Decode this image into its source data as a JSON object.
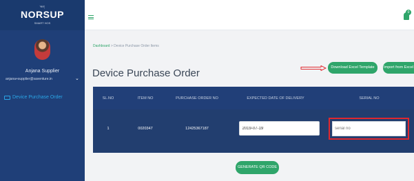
{
  "sidebar": {
    "brand_top": "༄༅།",
    "brand": "NORSUP",
    "brand_tagline": "SMART HOS",
    "user_name": "Anjana Supplier",
    "user_email": "anjana+supplier@saventure.in",
    "nav_items": [
      {
        "label": "Device Purchase Order",
        "icon": "monitor-icon"
      }
    ]
  },
  "topbar": {
    "notification_count": "0"
  },
  "breadcrumb": {
    "home": "Dashboard",
    "separator": ">",
    "current": "Device Purchase Order Items"
  },
  "page": {
    "title": "Device Purchase Order"
  },
  "actions": {
    "download_label": "Download Excel Template",
    "import_label": "Import from Excel"
  },
  "table": {
    "headers": [
      "SL.NO",
      "ITEM NO",
      "PURCHASE ORDER NO",
      "EXPECTED DATE OF DELIVERY",
      "SERIAL NO"
    ],
    "rows": [
      {
        "sl_no": "1",
        "item_no": "0020347",
        "po_no": "12425367187",
        "expected_date": "2019-07-19",
        "serial_placeholder": "serial no"
      }
    ]
  },
  "qr_button": {
    "label": "GENERATE QR CODE"
  },
  "colors": {
    "accent": "#2fa56a",
    "sidebar": "#1f3f78",
    "table_header": "#213f78",
    "highlight": "#e0282e"
  }
}
